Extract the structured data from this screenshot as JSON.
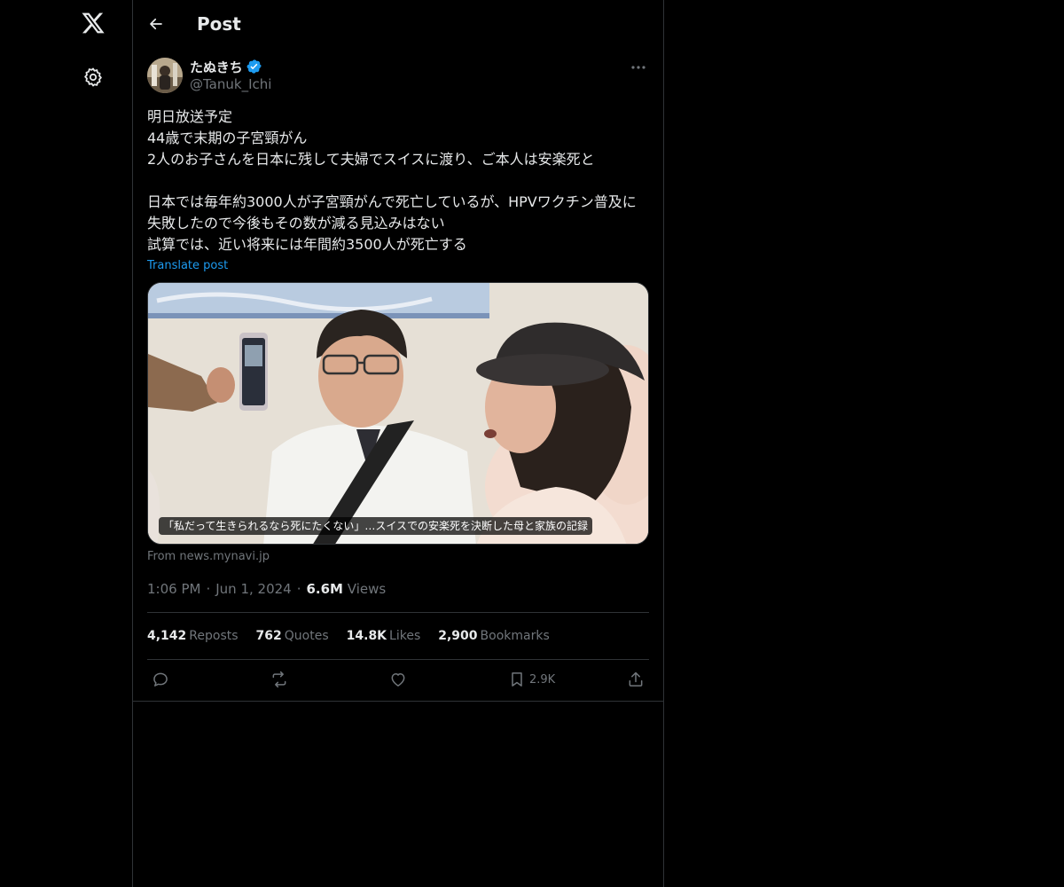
{
  "header": {
    "title": "Post"
  },
  "post": {
    "author": {
      "name": "たぬきち",
      "handle": "@Tanuk_Ichi"
    },
    "text": "明日放送予定\n44歳で末期の子宮頸がん\n2人のお子さんを日本に残して夫婦でスイスに渡り、ご本人は安楽死と\n\n日本では毎年約3000人が子宮頸がんで死亡しているが、HPVワクチン普及に失敗したので今後もその数が減る見込みはない\n試算では、近い将来には年間約3500人が死亡する",
    "translate_label": "Translate post",
    "media": {
      "caption": "「私だって生きられるなら死にたくない」…スイスでの安楽死を決断した母と家族の記録"
    },
    "source": "From news.mynavi.jp",
    "time": "1:06 PM",
    "date": "Jun 1, 2024",
    "views_count": "6.6M",
    "views_label": "Views",
    "stats": {
      "reposts_count": "4,142",
      "reposts_label": "Reposts",
      "quotes_count": "762",
      "quotes_label": "Quotes",
      "likes_count": "14.8K",
      "likes_label": "Likes",
      "bookmarks_count": "2,900",
      "bookmarks_label": "Bookmarks"
    },
    "actions": {
      "bookmark_count": "2.9K"
    }
  },
  "colors": {
    "background": "#000000",
    "text_primary": "#e7e9ea",
    "text_secondary": "#71767b",
    "accent": "#1d9bf0",
    "border": "#2f3336"
  }
}
